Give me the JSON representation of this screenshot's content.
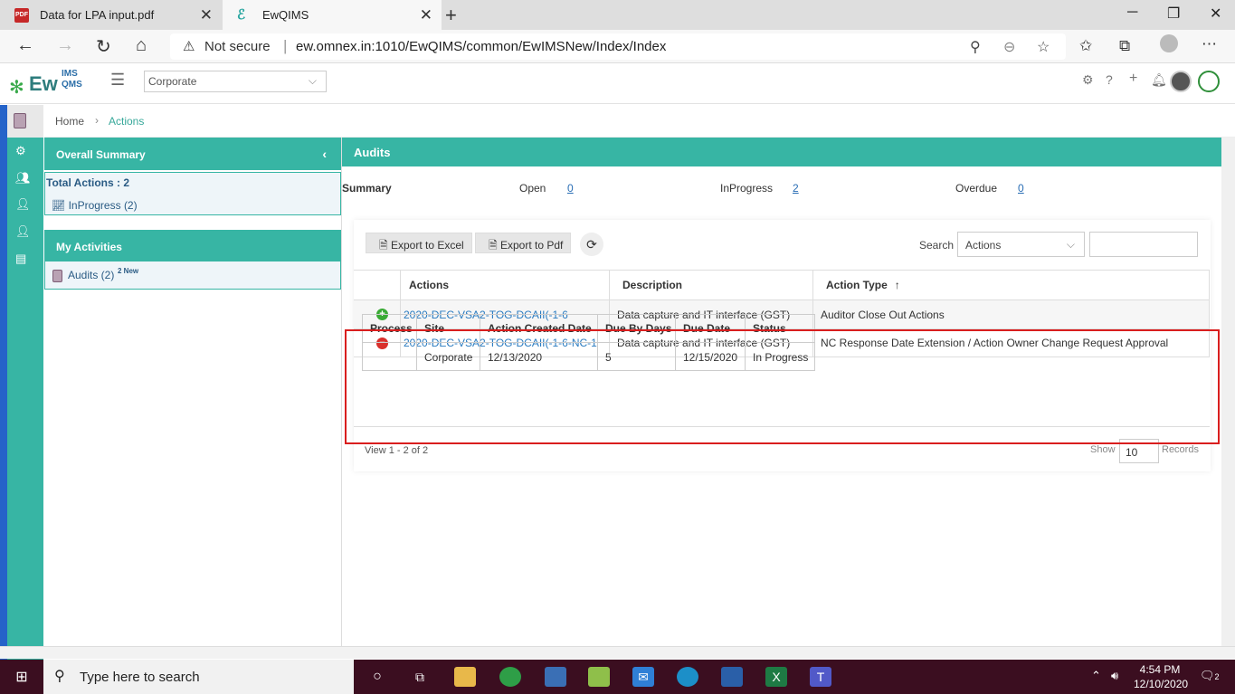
{
  "browser": {
    "tabs": [
      {
        "title": "Data for LPA input.pdf",
        "active": false
      },
      {
        "title": "EwQIMS",
        "active": true
      }
    ],
    "address": {
      "security": "Not secure",
      "url": "ew.omnex.in:1010/EwQIMS/common/EwIMSNew/Index/Index"
    }
  },
  "header": {
    "logo": {
      "ew": "Ew",
      "ims": "IMS",
      "qms": "QMS"
    },
    "org_select": "Corporate"
  },
  "breadcrumb": {
    "home": "Home",
    "current": "Actions"
  },
  "left_panel": {
    "overall_summary": {
      "title": "Overall Summary",
      "total_label": "Total Actions : 2",
      "inprogress_label": "InProgress (2)"
    },
    "my_activities": {
      "title": "My Activities",
      "audits_label": "Audits (2)",
      "audits_new": "2 New"
    }
  },
  "main": {
    "title": "Audits",
    "summary": {
      "label": "Summary",
      "open_label": "Open",
      "open_value": "0",
      "inprogress_label": "InProgress",
      "inprogress_value": "2",
      "overdue_label": "Overdue",
      "overdue_value": "0"
    },
    "toolbar": {
      "export_excel": "Export to Excel",
      "export_pdf": "Export to Pdf",
      "search_label": "Search",
      "search_field": "Actions",
      "search_value": ""
    },
    "table": {
      "columns": [
        "Actions",
        "Description",
        "Action Type"
      ],
      "rows": [
        {
          "action": "2020-DEC-VSA2-TOG-DCAII(-1-6",
          "description": "Data capture and IT interface (GST)",
          "type": "Auditor Close Out Actions",
          "expanded": false
        },
        {
          "action": "2020-DEC-VSA2-TOG-DCAII(-1-6-NC-1",
          "description": "Data capture and IT interface (GST)",
          "type": "NC Response Date Extension / Action Owner Change Request Approval",
          "expanded": true
        }
      ],
      "subtable": {
        "columns": [
          "Process",
          "Site",
          "Action Created Date",
          "Due By Days",
          "Due Date",
          "Status"
        ],
        "row": [
          "",
          "Corporate",
          "12/13/2020",
          "5",
          "12/15/2020",
          "In Progress"
        ]
      }
    },
    "pager": {
      "view_text": "View 1 - 2 of 2",
      "show_label": "Show",
      "page_size": "10",
      "records_label": "Records"
    }
  },
  "taskbar": {
    "search_placeholder": "Type here to search",
    "time": "4:54 PM",
    "date": "12/10/2020",
    "notifications": "2"
  },
  "colors": {
    "teal": "#37b5a4",
    "link": "#2a7bc0",
    "highlight": "#d91e1e",
    "taskbar": "#3b0e20"
  }
}
